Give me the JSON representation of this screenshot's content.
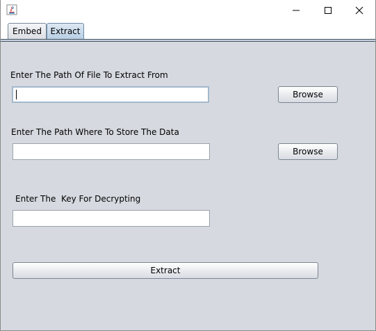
{
  "tabs": [
    {
      "label": "Embed",
      "selected": false
    },
    {
      "label": "Extract",
      "selected": true
    }
  ],
  "extract": {
    "source_label": "Enter The Path Of File To Extract From",
    "source_value": "",
    "source_browse": "Browse",
    "dest_label": "Enter The Path Where To Store The Data",
    "dest_value": "",
    "dest_browse": "Browse",
    "key_label": "Enter The  Key For Decrypting",
    "key_value": "",
    "extract_button": "Extract"
  },
  "icons": {
    "app": "java-icon",
    "minimize": "minimize-icon",
    "maximize": "maximize-icon",
    "close": "close-icon"
  },
  "colors": {
    "panel_bg": "#d6d9df",
    "selected_tab": "#b8cfe5"
  }
}
